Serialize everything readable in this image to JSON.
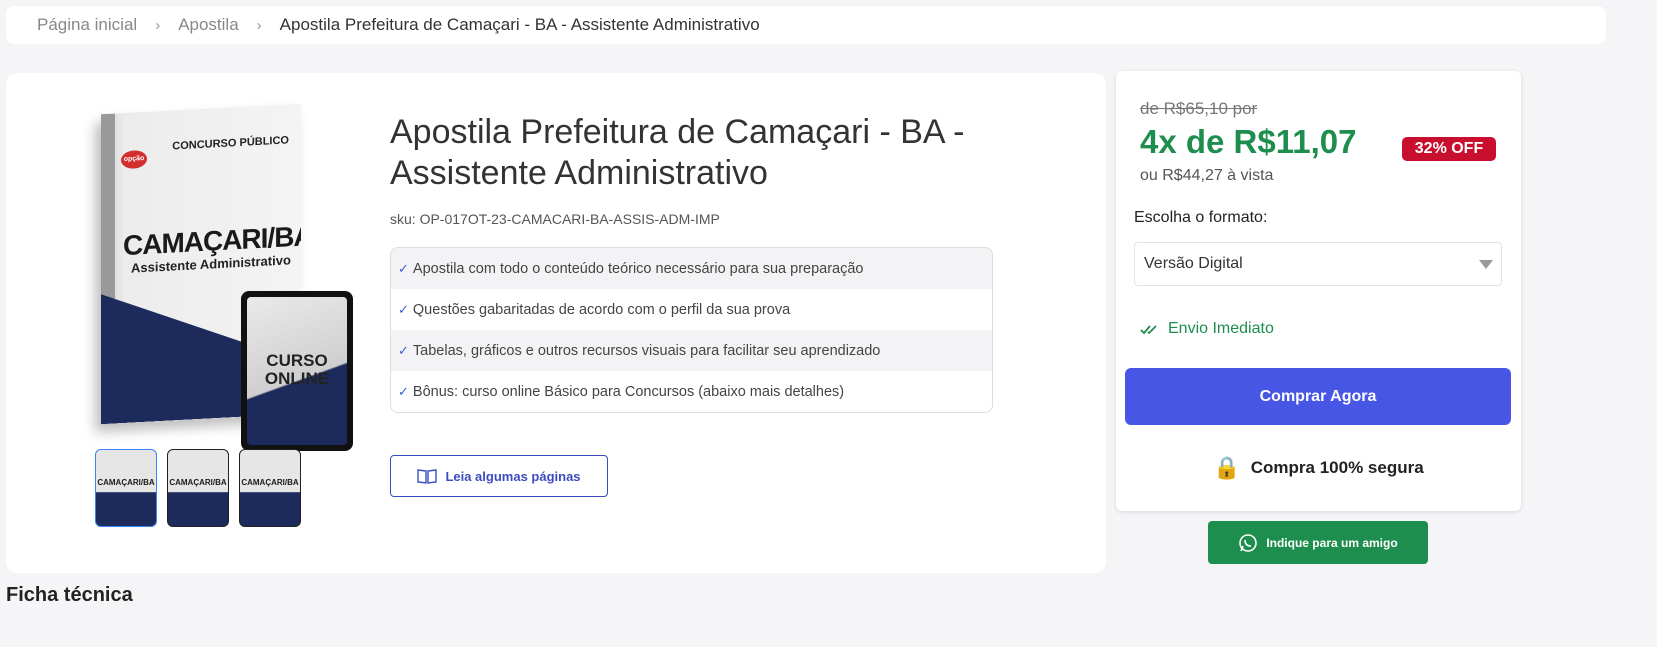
{
  "breadcrumb": {
    "home": "Página inicial",
    "category": "Apostila",
    "current": "Apostila Prefeitura de Camaçari - BA - Assistente Administrativo"
  },
  "product": {
    "title": "Apostila Prefeitura de Camaçari - BA - Assistente Administrativo",
    "sku": "sku: OP-017OT-23-CAMACARI-BA-ASSIS-ADM-IMP",
    "cover": {
      "top_label": "CONCURSO PÚBLICO",
      "logo": "opção",
      "title": "CAMAÇARI/BA",
      "subtitle": "Assistente Administrativo",
      "tablet_text": "CURSO ONLINE"
    },
    "thumbnails": [
      "CAMAÇARI/BA",
      "CAMAÇARI/BA",
      "CAMAÇARI/BA"
    ],
    "features": [
      "Apostila com todo o conteúdo teórico necessário para sua preparação",
      "Questões gabaritadas de acordo com o perfil da sua prova",
      "Tabelas, gráficos e outros recursos visuais para facilitar seu aprendizado",
      "Bônus: curso online Básico para Concursos (abaixo mais detalhes)"
    ],
    "read_button": "Leia algumas páginas"
  },
  "purchase": {
    "old_price": "de R$65,10 por",
    "installment": "4x de R$11,07",
    "discount": "32% OFF",
    "cash_price": "ou R$44,27 à vista",
    "format_label": "Escolha o formato:",
    "format_selected": "Versão Digital",
    "shipping": "Envio Imediato",
    "buy_button": "Comprar Agora",
    "secure": "Compra 100% segura",
    "share_button": "Indique para um amigo"
  },
  "section": {
    "title": "Ficha técnica"
  },
  "colors": {
    "accent": "#4856e6",
    "price_green": "#1e8e4e",
    "discount_red": "#c8102e",
    "navy": "#1d2a5c"
  }
}
